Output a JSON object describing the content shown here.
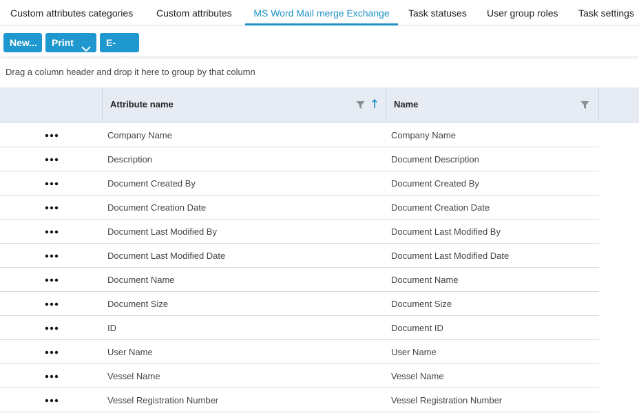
{
  "tabs": [
    {
      "label": "Custom attributes categories",
      "active": false
    },
    {
      "label": "Custom attributes",
      "active": false
    },
    {
      "label": "MS Word Mail merge Exchange",
      "active": true
    },
    {
      "label": "Task statuses",
      "active": false
    },
    {
      "label": "User group roles",
      "active": false
    },
    {
      "label": "Task settings",
      "active": false
    }
  ],
  "toolbar": {
    "new_label": "New...",
    "print_label": "Print",
    "email_label": "E-mail"
  },
  "group_hint": "Drag a column header and drop it here to group by that column",
  "grid": {
    "columns": [
      "Attribute name",
      "Name"
    ],
    "sort": {
      "column": "Attribute name",
      "direction": "ascending"
    },
    "rows": [
      {
        "attribute_name": "Company Name",
        "name": "Company Name"
      },
      {
        "attribute_name": "Description",
        "name": "Document Description"
      },
      {
        "attribute_name": "Document Created By",
        "name": "Document Created By"
      },
      {
        "attribute_name": "Document Creation Date",
        "name": "Document Creation Date"
      },
      {
        "attribute_name": "Document Last Modified By",
        "name": "Document Last Modified By"
      },
      {
        "attribute_name": "Document Last Modified Date",
        "name": "Document Last Modified Date"
      },
      {
        "attribute_name": "Document Name",
        "name": "Document Name"
      },
      {
        "attribute_name": "Document Size",
        "name": "Document Size"
      },
      {
        "attribute_name": "ID",
        "name": "Document ID"
      },
      {
        "attribute_name": "User Name",
        "name": "User Name"
      },
      {
        "attribute_name": "Vessel Name",
        "name": "Vessel Name"
      },
      {
        "attribute_name": "Vessel Registration Number",
        "name": "Vessel Registration Number"
      }
    ]
  },
  "colors": {
    "accent": "#1e90c8",
    "button": "#1f98cf",
    "header_bg": "#e6ebf4"
  }
}
